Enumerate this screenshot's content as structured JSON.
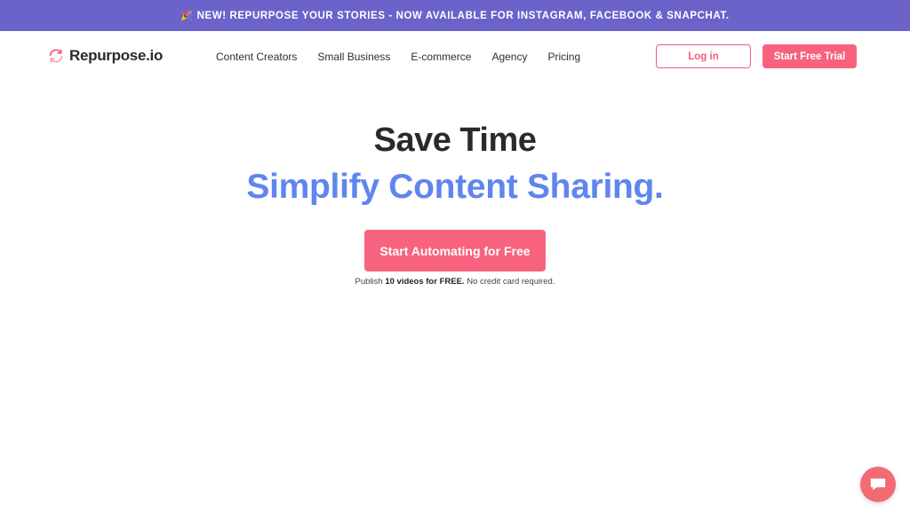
{
  "announcement": {
    "icon": "party-popper-icon",
    "emoji": "🎉",
    "text": "NEW! REPURPOSE YOUR STORIES - NOW AVAILABLE FOR INSTAGRAM, FACEBOOK & SNAPCHAT."
  },
  "header": {
    "logo_text": "Repurpose.io",
    "logo_icon": "refresh-arrows-icon",
    "menu": [
      {
        "label": "Content Creators"
      },
      {
        "label": "Small Business"
      },
      {
        "label": "E-commerce"
      },
      {
        "label": "Agency"
      },
      {
        "label": "Pricing"
      }
    ],
    "login_label": "Log in",
    "trial_label": "Start Free Trial"
  },
  "hero": {
    "title": "Save Time",
    "subtitle": "Simplify Content Sharing.",
    "cta_label": "Start Automating for Free",
    "note_prefix": "Publish ",
    "note_bold": "10 videos for FREE.",
    "note_suffix": " No credit card required."
  },
  "chat_widget": {
    "icon": "chat-bubble-icon"
  },
  "colors": {
    "announcement_bg": "#6b63c9",
    "accent_pink": "#f7637e",
    "accent_blue": "#5f85ee",
    "chat_bg": "#f26b73"
  }
}
